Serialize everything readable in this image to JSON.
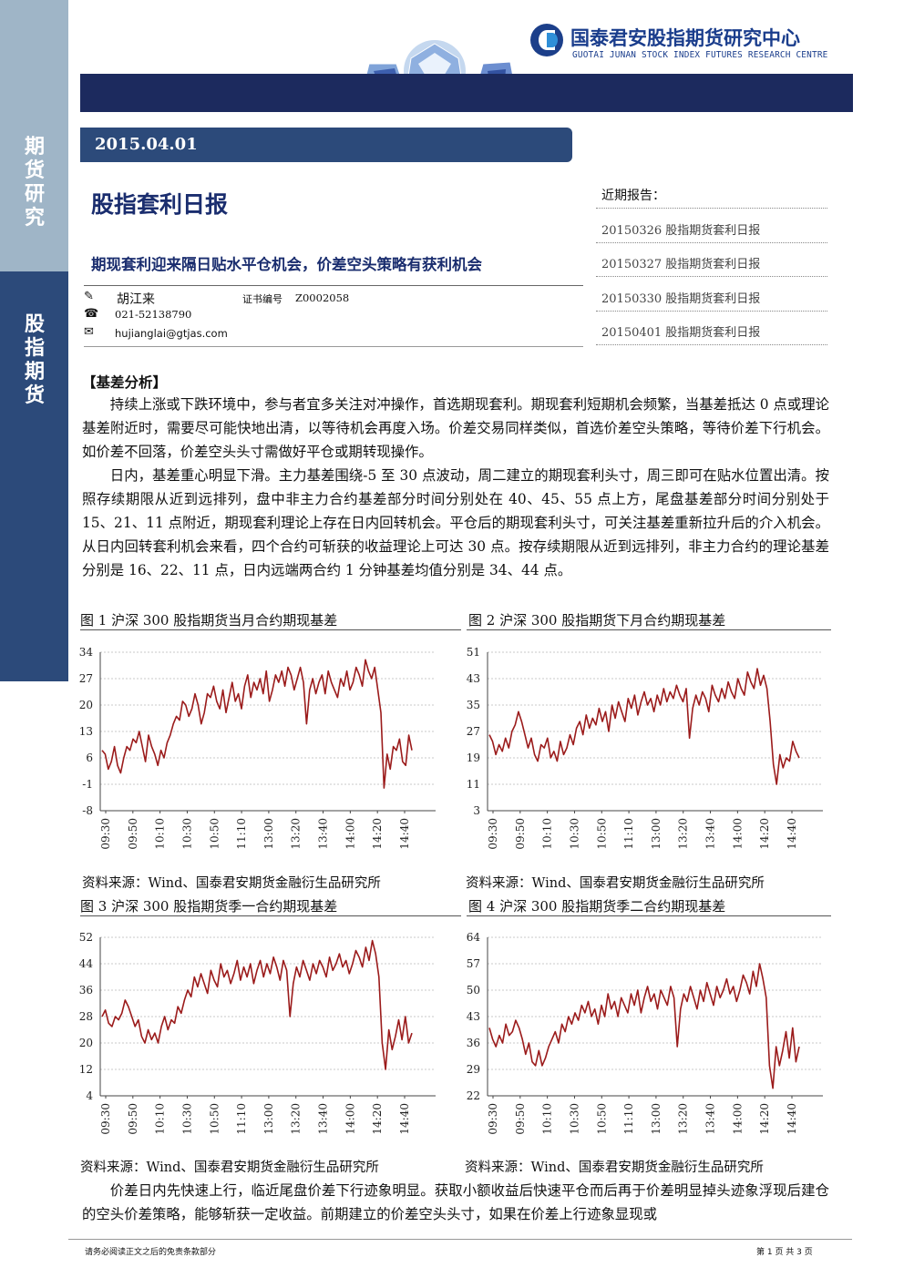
{
  "header": {
    "org_cn": "国泰君安股指期货研究中心",
    "org_en": "GUOTAI JUNAN STOCK INDEX FUTURES RESEARCH CENTRE"
  },
  "sidebar": {
    "top_label": "期货研究",
    "mid_label": "股指期货"
  },
  "date": "2015.04.01",
  "title": "股指套利日报",
  "subtitle": "期现套利迎来隔日贴水平仓机会，价差空头策略有获利机会",
  "author": {
    "name": "胡江来",
    "cert_label": "证书编号",
    "cert_no": "Z0002058",
    "phone": "021-52138790",
    "email": "hujianglai@gtjas.com"
  },
  "recent": {
    "title": "近期报告：",
    "items": [
      "20150326 股指期货套利日报",
      "20150327 股指期货套利日报",
      "20150330 股指期货套利日报",
      "20150401 股指期货套利日报"
    ]
  },
  "section_heading": "【基差分析】",
  "paragraphs": [
    "持续上涨或下跌环境中，参与者宜多关注对冲操作，首选期现套利。期现套利短期机会频繁，当基差抵达 0 点或理论基差附近时，需要尽可能快地出清，以等待机会再度入场。价差交易同样类似，首选价差空头策略，等待价差下行机会。如价差不回落，价差空头头寸需做好平仓或期转现操作。",
    "日内，基差重心明显下滑。主力基差围绕-5 至 30 点波动，周二建立的期现套利头寸，周三即可在贴水位置出清。按照存续期限从近到远排列，盘中非主力合约基差部分时间分别处在 40、45、55 点上方，尾盘基差部分时间分别处于 15、21、11 点附近，期现套利理论上存在日内回转机会。平仓后的期现套利头寸，可关注基差重新拉升后的介入机会。从日内回转套利机会来看，四个合约可斩获的收益理论上可达 30 点。按存续期限从近到远排列，非主力合约的理论基差分别是 16、22、11 点，日内远端两合约 1 分钟基差均值分别是 34、44 点。",
    "价差日内先快速上行，临近尾盘价差下行迹象明显。获取小额收益后快速平仓而后再于价差明显掉头迹象浮现后建仓的空头价差策略，能够斩获一定收益。前期建立的价差空头头寸，如果在价差上行迹象显现或"
  ],
  "source_text": "资料来源：Wind、国泰君安期货金融衍生品研究所",
  "footer": {
    "left": "请务必阅读正文之后的免责条款部分",
    "right": "第 1 页 共 3 页"
  },
  "chart_data": [
    {
      "type": "line",
      "title": "图 1 沪深 300 股指期货当月合约期现基差",
      "categories": [
        "09:30",
        "09:50",
        "10:10",
        "10:30",
        "10:50",
        "11:10",
        "13:00",
        "13:20",
        "13:40",
        "14:00",
        "14:20",
        "14:40"
      ],
      "yticks": [
        34,
        27,
        20,
        13,
        6,
        -1,
        -8
      ],
      "ylim": [
        -8,
        34
      ],
      "color": "#9b1b1b",
      "values": [
        8,
        7,
        3,
        5,
        9,
        4,
        2,
        6,
        9,
        8,
        11,
        10,
        13,
        9,
        5,
        12,
        9,
        7,
        4,
        8,
        6,
        10,
        12,
        15,
        17,
        16,
        21,
        20,
        17,
        19,
        23,
        20,
        15,
        18,
        23,
        22,
        25,
        21,
        19,
        24,
        18,
        22,
        26,
        21,
        23,
        19,
        25,
        28,
        22,
        26,
        24,
        27,
        23,
        29,
        21,
        24,
        28,
        26,
        29,
        25,
        30,
        28,
        24,
        27,
        30,
        26,
        15,
        24,
        27,
        23,
        26,
        28,
        23,
        29,
        26,
        24,
        22,
        27,
        25,
        29,
        24,
        26,
        30,
        28,
        25,
        32,
        29,
        27,
        30,
        24,
        18,
        -2,
        7,
        3,
        9,
        8,
        11,
        5,
        4,
        12,
        8
      ]
    },
    {
      "type": "line",
      "title": "图 2 沪深 300 股指期货下月合约期现基差",
      "categories": [
        "09:30",
        "09:50",
        "10:10",
        "10:30",
        "10:50",
        "11:10",
        "13:00",
        "13:20",
        "13:40",
        "14:00",
        "14:20",
        "14:40"
      ],
      "yticks": [
        51,
        43,
        35,
        27,
        19,
        11,
        3
      ],
      "ylim": [
        3,
        51
      ],
      "color": "#9b1b1b",
      "values": [
        26,
        24,
        20,
        23,
        21,
        25,
        22,
        27,
        29,
        33,
        30,
        26,
        22,
        25,
        20,
        18,
        23,
        22,
        25,
        19,
        21,
        18,
        24,
        20,
        22,
        26,
        23,
        28,
        30,
        26,
        32,
        28,
        31,
        29,
        34,
        30,
        33,
        27,
        35,
        31,
        36,
        33,
        30,
        37,
        34,
        38,
        32,
        36,
        39,
        35,
        37,
        33,
        38,
        35,
        40,
        36,
        39,
        37,
        41,
        38,
        36,
        40,
        25,
        34,
        38,
        35,
        39,
        37,
        33,
        41,
        38,
        36,
        40,
        37,
        42,
        39,
        37,
        43,
        40,
        38,
        45,
        42,
        40,
        46,
        41,
        44,
        40,
        30,
        17,
        11,
        20,
        16,
        19,
        18,
        24,
        21,
        19
      ]
    },
    {
      "type": "line",
      "title": "图 3 沪深 300 股指期货季一合约期现基差",
      "categories": [
        "09:30",
        "09:50",
        "10:10",
        "10:30",
        "10:50",
        "11:10",
        "13:00",
        "13:20",
        "13:40",
        "14:00",
        "14:20",
        "14:40"
      ],
      "yticks": [
        52,
        44,
        36,
        28,
        20,
        12,
        4
      ],
      "ylim": [
        4,
        52
      ],
      "color": "#9b1b1b",
      "values": [
        28,
        30,
        26,
        25,
        28,
        27,
        29,
        33,
        31,
        28,
        25,
        27,
        22,
        20,
        24,
        21,
        23,
        20,
        25,
        28,
        24,
        27,
        26,
        31,
        29,
        33,
        36,
        34,
        40,
        37,
        41,
        38,
        35,
        42,
        39,
        37,
        44,
        40,
        42,
        38,
        41,
        45,
        39,
        43,
        40,
        44,
        38,
        42,
        45,
        40,
        44,
        41,
        46,
        43,
        39,
        45,
        42,
        28,
        38,
        43,
        40,
        45,
        42,
        39,
        44,
        41,
        45,
        43,
        40,
        46,
        42,
        44,
        47,
        43,
        45,
        41,
        44,
        48,
        46,
        43,
        49,
        45,
        51,
        47,
        40,
        20,
        12,
        24,
        18,
        22,
        27,
        21,
        28,
        20,
        23
      ]
    },
    {
      "type": "line",
      "title": "图 4 沪深 300 股指期货季二合约期现基差",
      "categories": [
        "09:30",
        "09:50",
        "10:10",
        "10:30",
        "10:50",
        "11:10",
        "13:00",
        "13:20",
        "13:40",
        "14:00",
        "14:20",
        "14:40"
      ],
      "yticks": [
        64,
        57,
        50,
        43,
        36,
        29,
        22
      ],
      "ylim": [
        22,
        64
      ],
      "color": "#9b1b1b",
      "values": [
        40,
        37,
        35,
        38,
        36,
        41,
        38,
        39,
        42,
        40,
        37,
        33,
        36,
        31,
        30,
        34,
        30,
        32,
        35,
        37,
        39,
        36,
        41,
        39,
        43,
        41,
        44,
        42,
        46,
        44,
        47,
        43,
        45,
        41,
        46,
        43,
        49,
        45,
        47,
        43,
        48,
        46,
        44,
        49,
        46,
        50,
        44,
        48,
        51,
        47,
        49,
        45,
        50,
        48,
        46,
        51,
        48,
        35,
        45,
        49,
        47,
        51,
        48,
        45,
        50,
        47,
        52,
        49,
        46,
        51,
        48,
        50,
        53,
        49,
        51,
        47,
        50,
        54,
        52,
        49,
        55,
        51,
        57,
        53,
        48,
        30,
        24,
        35,
        30,
        34,
        39,
        32,
        40,
        31,
        35
      ]
    }
  ]
}
